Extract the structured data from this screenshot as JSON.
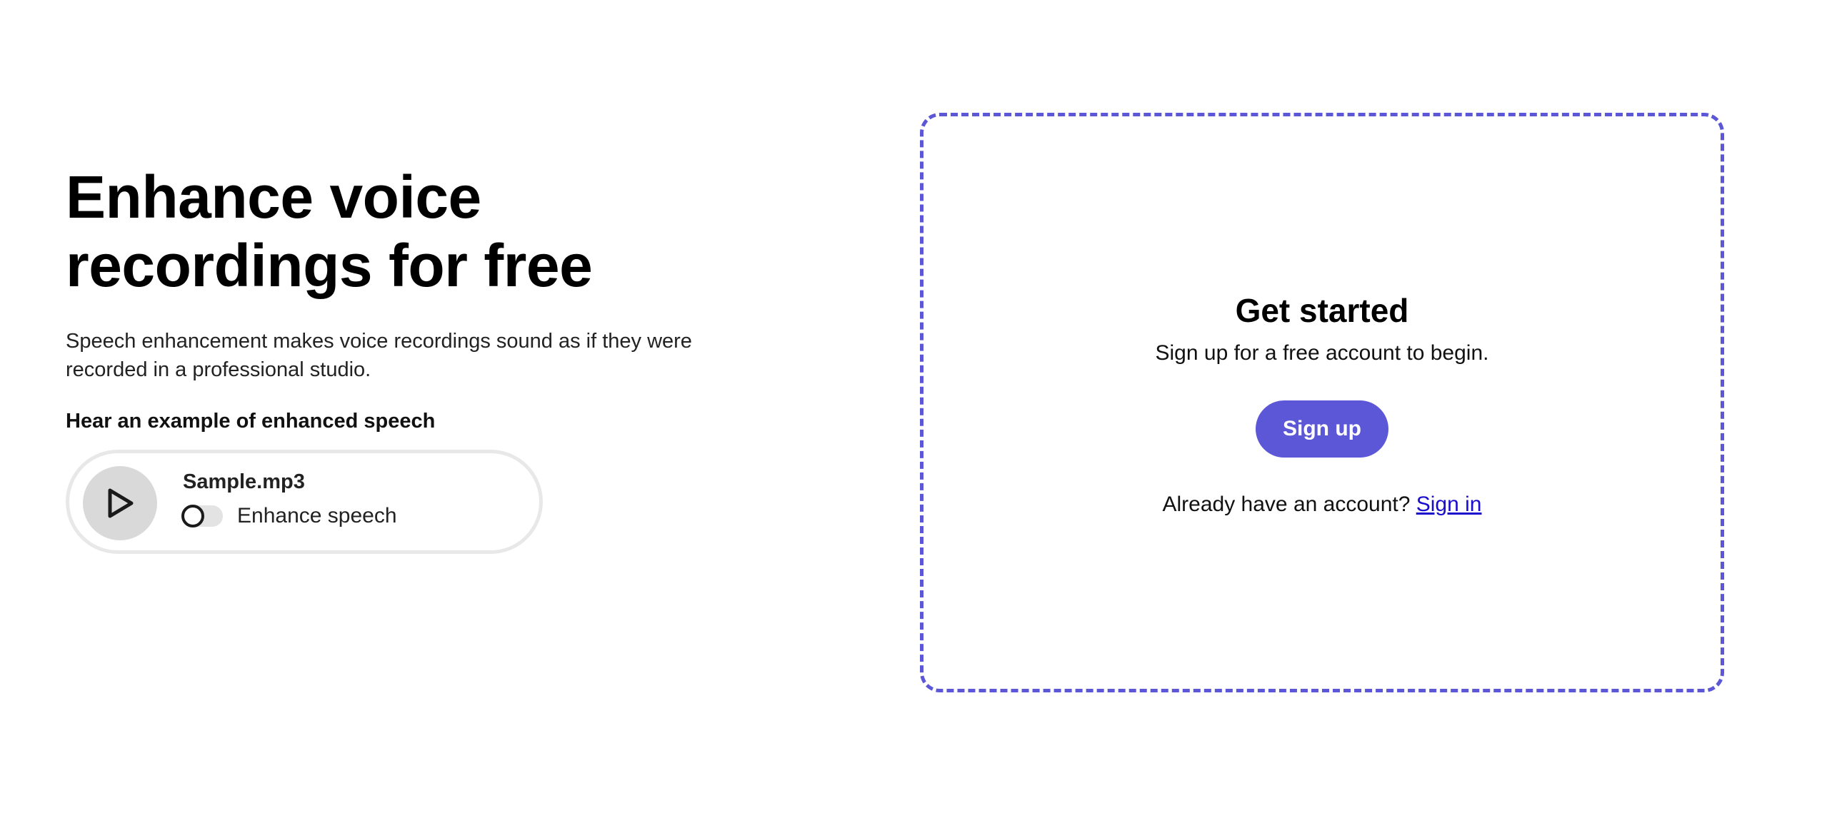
{
  "hero": {
    "headline": "Enhance voice recordings for free",
    "description": "Speech enhancement makes voice recordings sound as if they were recorded in a professional studio.",
    "example_label": "Hear an example of enhanced speech"
  },
  "sample": {
    "file_name": "Sample.mp3",
    "play_icon": "play-icon",
    "toggle_label": "Enhance speech",
    "toggle_on": false
  },
  "signup_panel": {
    "title": "Get started",
    "subtitle": "Sign up for a free account to begin.",
    "signup_button": "Sign up",
    "signin_prompt": "Already have an account?",
    "signin_link": "Sign in"
  },
  "colors": {
    "accent": "#5b57d6",
    "link": "#1a0dcc",
    "play_button_bg": "#d9d9d9",
    "card_border": "#e8e8e8"
  }
}
